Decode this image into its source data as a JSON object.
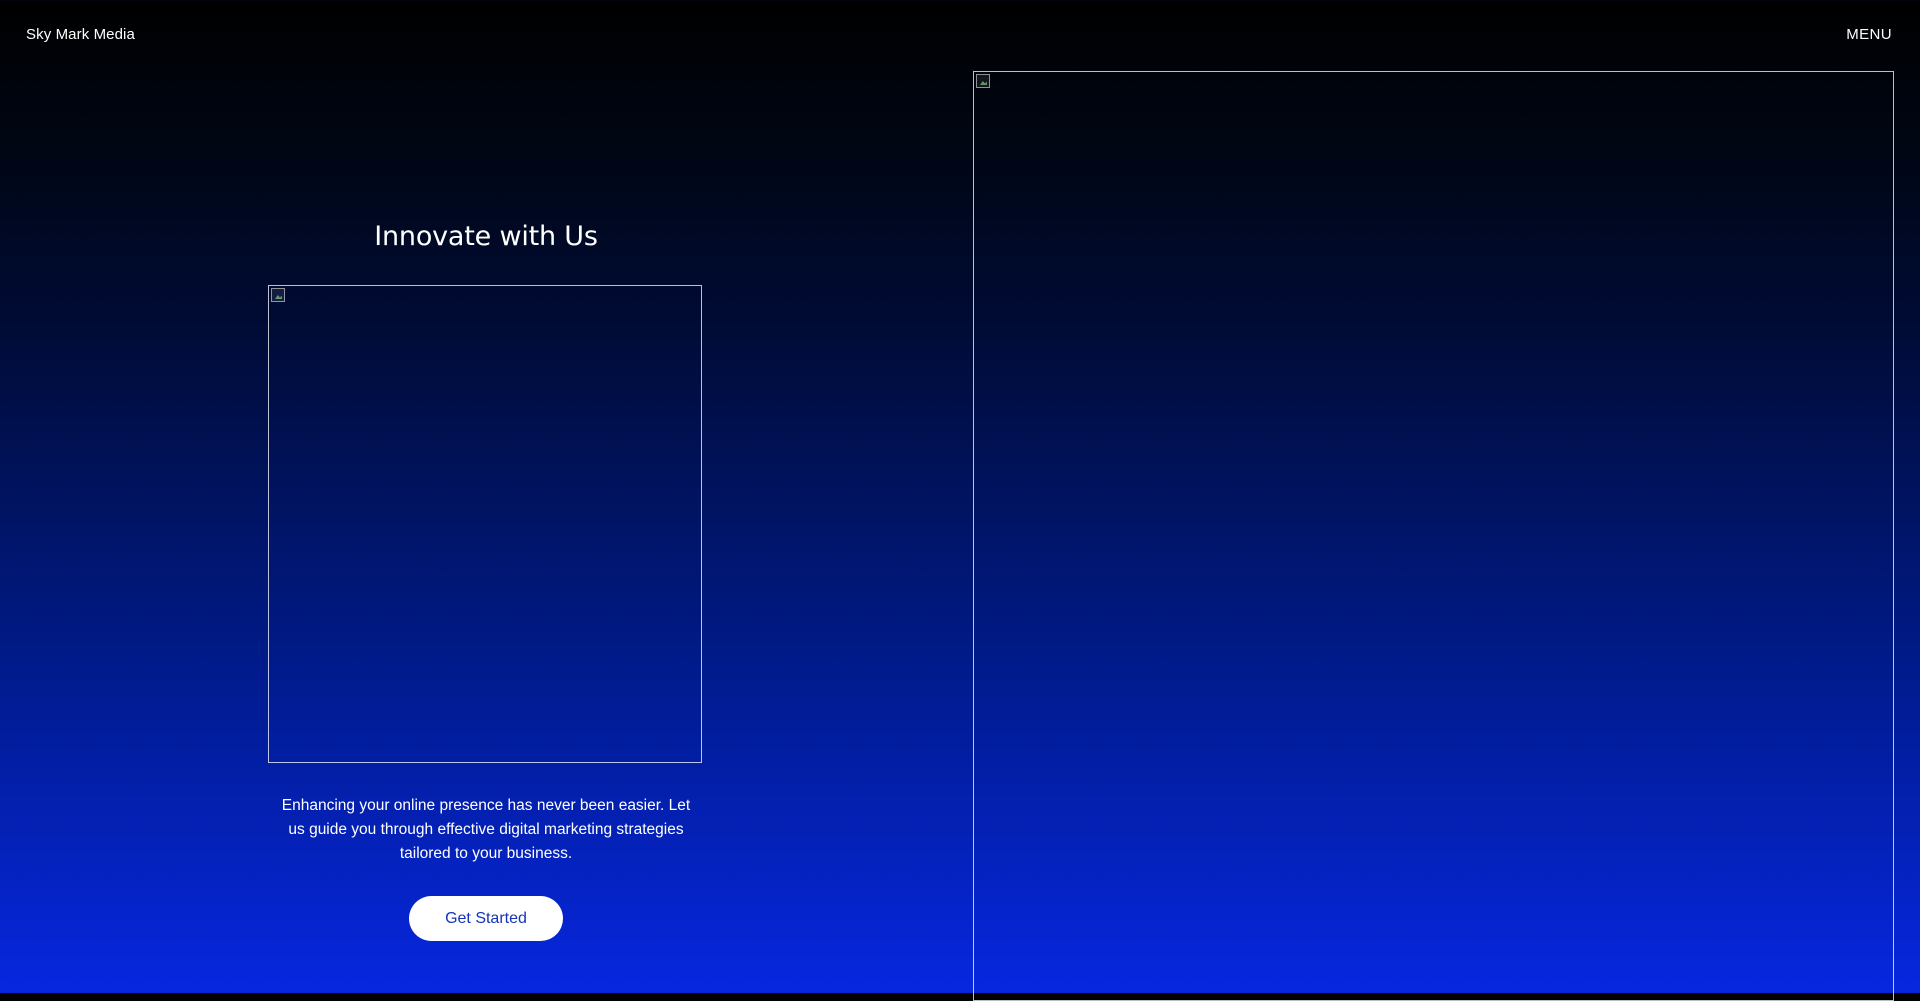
{
  "header": {
    "brand": "Sky Mark Media",
    "menu_label": "MENU"
  },
  "hero": {
    "title": "Innovate with Us",
    "description": "Enhancing your online presence has never been easier. Let us guide you through effective digital marketing strategies tailored to your business.",
    "cta_label": "Get Started"
  },
  "colors": {
    "gradient_top": "#000000",
    "gradient_bottom": "#0727e0",
    "cta_text": "#1434b8"
  },
  "icons": {
    "broken_image": "broken-image-icon"
  }
}
